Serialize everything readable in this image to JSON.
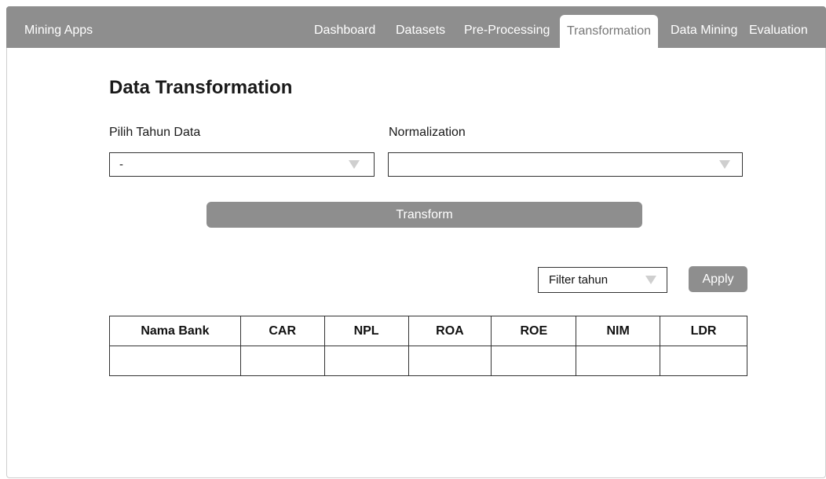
{
  "navbar": {
    "brand": "Mining Apps",
    "items": [
      {
        "label": "Dashboard"
      },
      {
        "label": "Datasets"
      },
      {
        "label": "Pre-Processing"
      },
      {
        "label": "Transformation",
        "active": true
      },
      {
        "label": "Data Mining"
      },
      {
        "label": "Evaluation"
      }
    ]
  },
  "main": {
    "title": "Data Transformation",
    "year_label": "Pilih Tahun Data",
    "year_value": "-",
    "normalization_label": "Normalization",
    "normalization_value": "",
    "transform_button": "Transform"
  },
  "filter": {
    "placeholder": "Filter tahun",
    "apply_label": "Apply"
  },
  "table": {
    "headers": [
      "Nama Bank",
      "CAR",
      "NPL",
      "ROA",
      "ROE",
      "NIM",
      "LDR"
    ],
    "rows": [
      [
        "",
        "",
        "",
        "",
        "",
        "",
        ""
      ]
    ]
  },
  "colors": {
    "navbar": "#8e8e8e",
    "button": "#8e8e8e",
    "caret": "#cfcfcf"
  }
}
